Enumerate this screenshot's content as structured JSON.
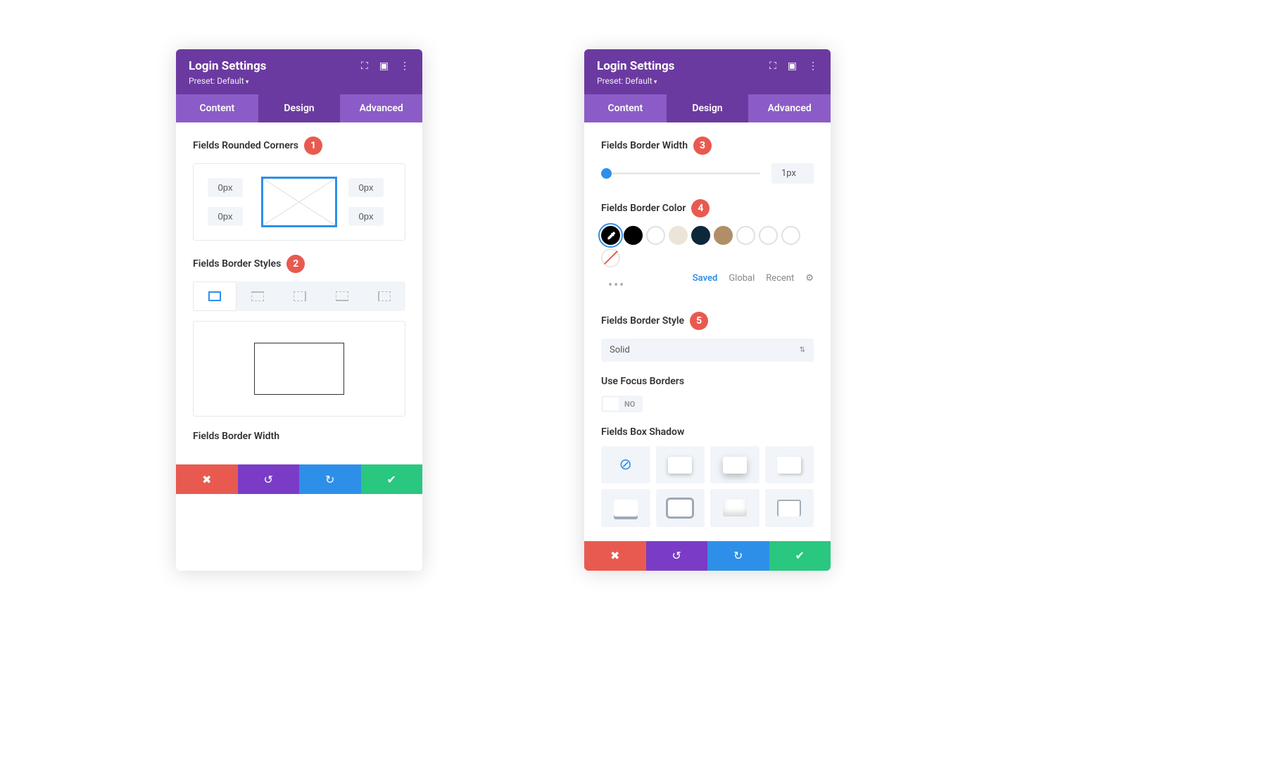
{
  "header": {
    "title": "Login Settings",
    "preset": "Preset: Default"
  },
  "tabs": {
    "content": "Content",
    "design": "Design",
    "advanced": "Advanced"
  },
  "panel1": {
    "rounded_label": "Fields Rounded Corners",
    "badge1": "1",
    "tl": "0px",
    "tr": "0px",
    "bl": "0px",
    "br": "0px",
    "styles_label": "Fields Border Styles",
    "badge2": "2",
    "width_label": "Fields Border Width"
  },
  "panel2": {
    "width_label": "Fields Border Width",
    "badge3": "3",
    "width_value": "1px",
    "color_label": "Fields Border Color",
    "badge4": "4",
    "color_tabs": {
      "saved": "Saved",
      "global": "Global",
      "recent": "Recent"
    },
    "style_label": "Fields Border Style",
    "badge5": "5",
    "style_value": "Solid",
    "focus_label": "Use Focus Borders",
    "focus_value": "NO",
    "shadow_label": "Fields Box Shadow"
  },
  "swatches": [
    {
      "color": "#000000"
    },
    {
      "color": "#ffffff"
    },
    {
      "color": "#ede4d9"
    },
    {
      "color": "#0d2838"
    },
    {
      "color": "#b08f68"
    },
    {
      "color": "#ffffff"
    },
    {
      "color": "#ffffff"
    },
    {
      "color": "#ffffff"
    }
  ]
}
